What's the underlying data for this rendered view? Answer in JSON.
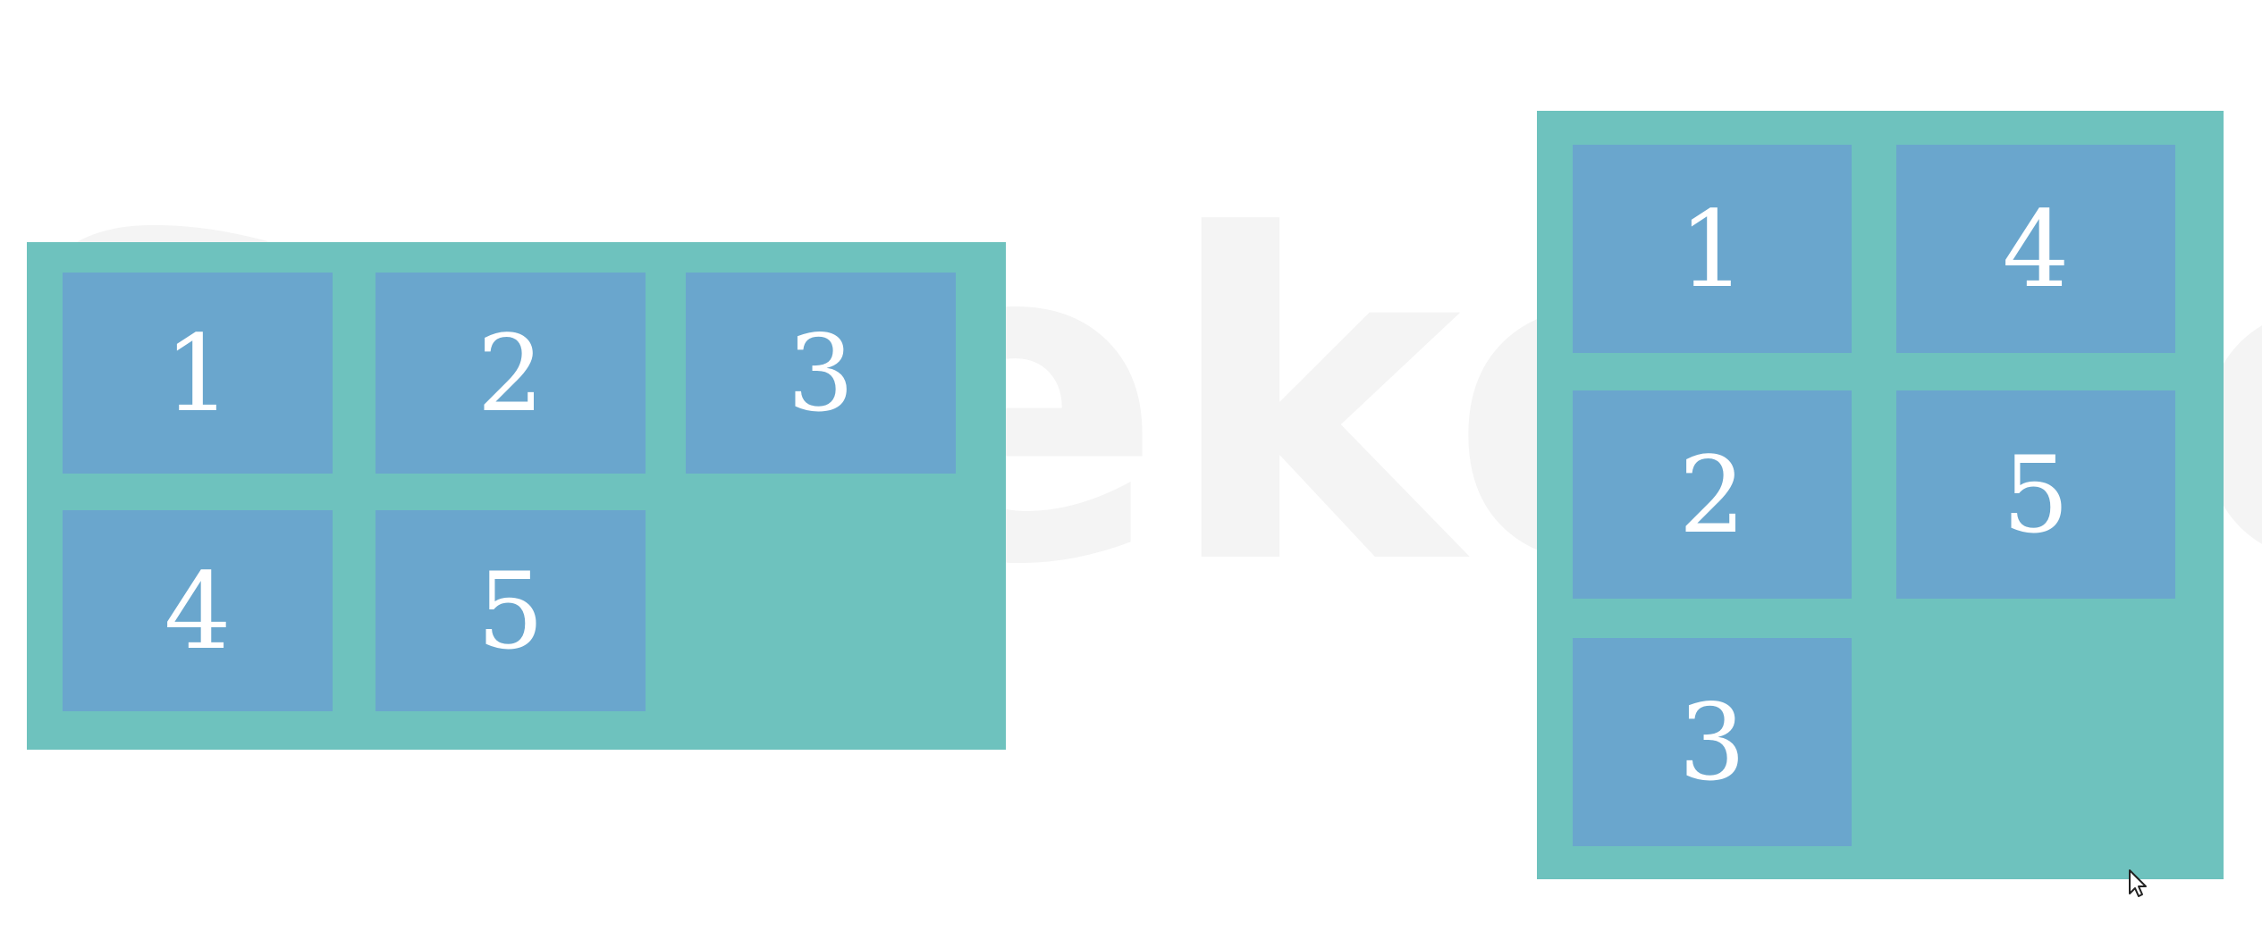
{
  "watermark": {
    "text": "Sureke.com"
  },
  "row_layout": {
    "items": [
      "1",
      "2",
      "3",
      "4",
      "5"
    ]
  },
  "column_layout": {
    "items": [
      "1",
      "2",
      "3",
      "4",
      "5"
    ]
  },
  "colors": {
    "container": "#6ec2be",
    "item": "#6aa6cd",
    "item_text": "#ffffff",
    "background": "#ffffff"
  },
  "icons": {
    "cursor": "mouse-pointer-icon"
  }
}
